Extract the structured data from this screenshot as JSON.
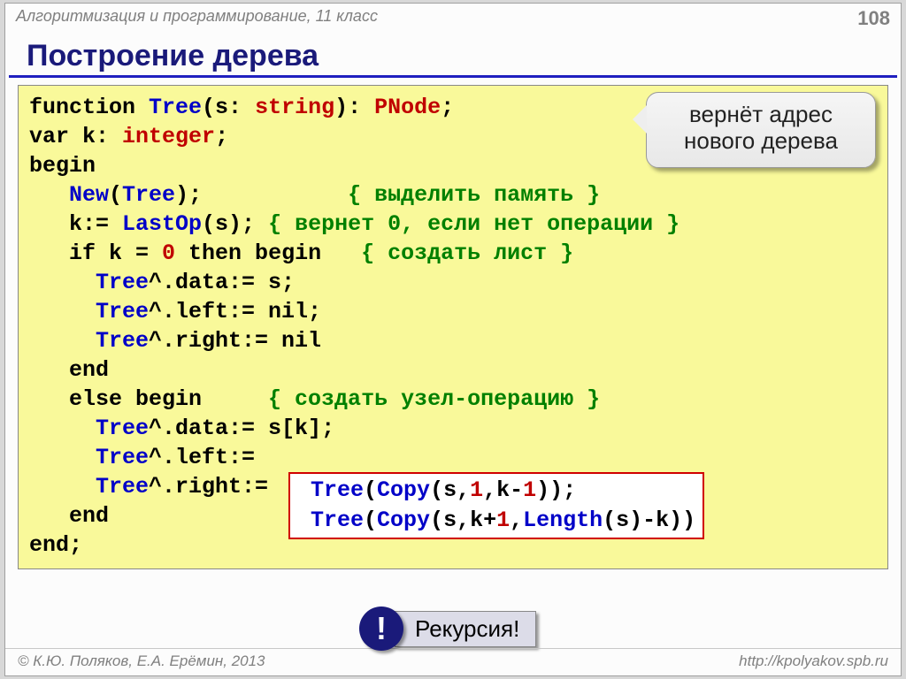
{
  "header": {
    "subject": "Алгоритмизация и программирование, 11 класс",
    "page": "108"
  },
  "title": "Построение дерева",
  "bubble": "вернёт адрес нового дерева",
  "code": {
    "l1_function": "function ",
    "l1_tree": "Tree",
    "l1_ps": "(s: ",
    "l1_string": "string",
    "l1_close": "): ",
    "l1_pnode": "PNode",
    "l1_semi": ";",
    "l2": "var k: ",
    "l2_int": "integer",
    "l2_semi": ";",
    "l3": "begin",
    "l4a": "   ",
    "l4_new": "New",
    "l4b": "(",
    "l4_tree": "Tree",
    "l4c": ");           ",
    "l4_cmt": "{ выделить память }",
    "l5a": "   k:= ",
    "l5_last": "LastOp",
    "l5b": "(s); ",
    "l5_cmt": "{ вернет 0, если нет операции }",
    "l6a": "   if k = ",
    "l6_zero": "0",
    "l6b": " then begin   ",
    "l6_cmt": "{ создать лист }",
    "l7a": "     ",
    "l7_tree": "Tree",
    "l7b": "^.data:= s;",
    "l8a": "     ",
    "l8_tree": "Tree",
    "l8b": "^.left:= nil;",
    "l9a": "     ",
    "l9_tree": "Tree",
    "l9b": "^.right:= nil",
    "l10": "   end",
    "l11a": "   else begin     ",
    "l11_cmt": "{ создать узел-операцию }",
    "l12a": "     ",
    "l12_tree": "Tree",
    "l12b": "^.data:= s[k];",
    "l13a": "     ",
    "l13_tree": "Tree",
    "l13b": "^.left:=",
    "l14a": "     ",
    "l14_tree": "Tree",
    "l14b": "^.right:=",
    "l15": "   end",
    "l16": "end;"
  },
  "redbox": {
    "r1a": " ",
    "r1_tree": "Tree",
    "r1b": "(",
    "r1_copy": "Copy",
    "r1c": "(s,",
    "r1_n1": "1",
    "r1d": ",k-",
    "r1_n2": "1",
    "r1e": "));",
    "r2a": " ",
    "r2_tree": "Tree",
    "r2b": "(",
    "r2_copy": "Copy",
    "r2c": "(s,k+",
    "r2_n1": "1",
    "r2d": ",",
    "r2_len": "Length",
    "r2e": "(s)-k))"
  },
  "recursion": {
    "mark": "!",
    "label": "Рекурсия!"
  },
  "footer": {
    "authors": "© К.Ю. Поляков, Е.А. Ерёмин, 2013",
    "url": "http://kpolyakov.spb.ru"
  }
}
